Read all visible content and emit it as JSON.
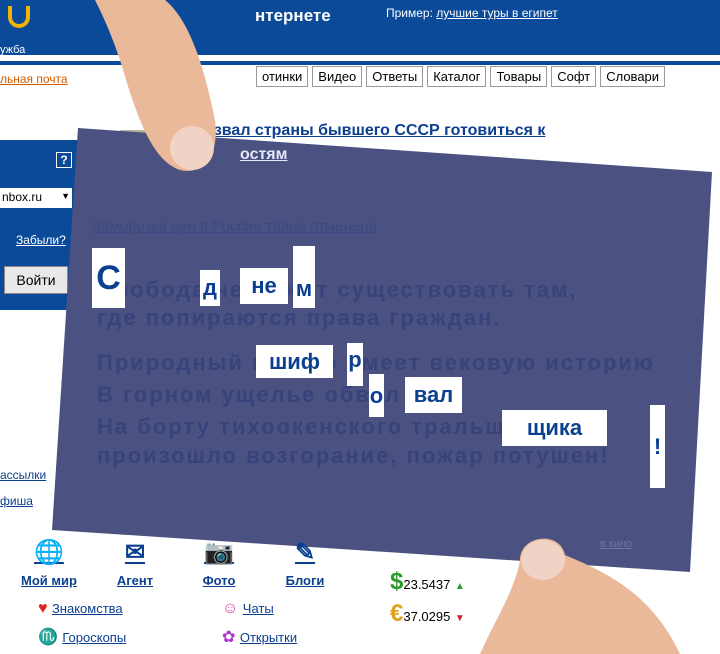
{
  "header": {
    "logo_caption": "ужба",
    "title": "нтернете",
    "example_label": "Пример:",
    "example_link": "лучшие туры в египет"
  },
  "mail_link": "льная почта",
  "tabs": [
    "отинки",
    "Видео",
    "Ответы",
    "Каталог",
    "Товары",
    "Софт",
    "Словари"
  ],
  "news": {
    "headline_1": "извал страны бывшего СССР готовиться к",
    "headline_2": "остям",
    "headline_3": "Заморозка цен в России тайно отменена"
  },
  "login": {
    "help": "?",
    "domain": "nbox.ru",
    "forgot": "Забыли?",
    "submit": "Войти"
  },
  "left_links": [
    "ассылки",
    "фиша"
  ],
  "card": {
    "color": "#4b5281",
    "lines": [
      "Свобода не может существовать там,",
      "где попираются права граждан.",
      "Природный шифер имеет вековую историю",
      "В горном ущелье обвал",
      "На борту тихоокенского тральщика",
      "произошло возгорание, пожар потушен!"
    ],
    "highlights": [
      "С",
      "д",
      "не",
      "м",
      "шиф",
      "р",
      "о",
      "вал",
      "щика",
      "!"
    ]
  },
  "services": [
    {
      "label": "Мой мир",
      "icon": "globe-user-icon"
    },
    {
      "label": "Агент",
      "icon": "envelope-icon"
    },
    {
      "label": "Фото",
      "icon": "camera-icon"
    },
    {
      "label": "Блоги",
      "icon": "blog-pen-icon"
    }
  ],
  "links": [
    {
      "label": "Знакомства",
      "icon": "heart-icon"
    },
    {
      "label": "Чаты",
      "icon": "chat-icon"
    },
    {
      "label": "Гороскопы",
      "icon": "zodiac-icon"
    },
    {
      "label": "Открытки",
      "icon": "postcard-icon"
    }
  ],
  "rates": [
    {
      "symbol": "$",
      "value": "23.5437",
      "trend": "▲",
      "color": "#2a9a2a"
    },
    {
      "symbol": "€",
      "value": "37.0295",
      "trend": "▼",
      "color": "#cc2222"
    }
  ],
  "misc": {
    "partial": "в кино"
  }
}
